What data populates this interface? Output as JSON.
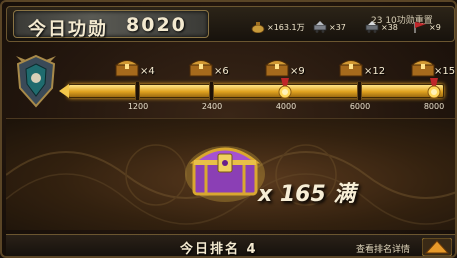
{
  "header": {
    "title": "今日功勋",
    "score": "8020",
    "reset_note": "23 10功勋重置",
    "rewards": [
      {
        "icon": "coin-bag-icon",
        "amount": "×163.1万"
      },
      {
        "icon": "ore-cart-icon",
        "amount": "×37"
      },
      {
        "icon": "ore-cart-icon",
        "amount": "×38"
      },
      {
        "icon": "red-flag-icon",
        "amount": "×9"
      }
    ]
  },
  "progress": {
    "current": 8020,
    "max": 8000,
    "fill_fraction": 1.0,
    "milestones": [
      {
        "threshold": "1200",
        "chest_multiplier": "×4",
        "reached": true
      },
      {
        "threshold": "2400",
        "chest_multiplier": "×6",
        "reached": true
      },
      {
        "threshold": "4000",
        "chest_multiplier": "×9",
        "reached": true
      },
      {
        "threshold": "6000",
        "chest_multiplier": "×12",
        "reached": true
      },
      {
        "threshold": "8000",
        "chest_multiplier": "×15",
        "reached": true
      }
    ]
  },
  "main": {
    "chest_reward": "x 165 满"
  },
  "footer": {
    "rank_text": "今日排名 4",
    "details_label": "查看排名详情"
  },
  "colors": {
    "gold": "#f2c64a",
    "chest_purple": "#8b3fb5",
    "text": "#f4ead0"
  }
}
